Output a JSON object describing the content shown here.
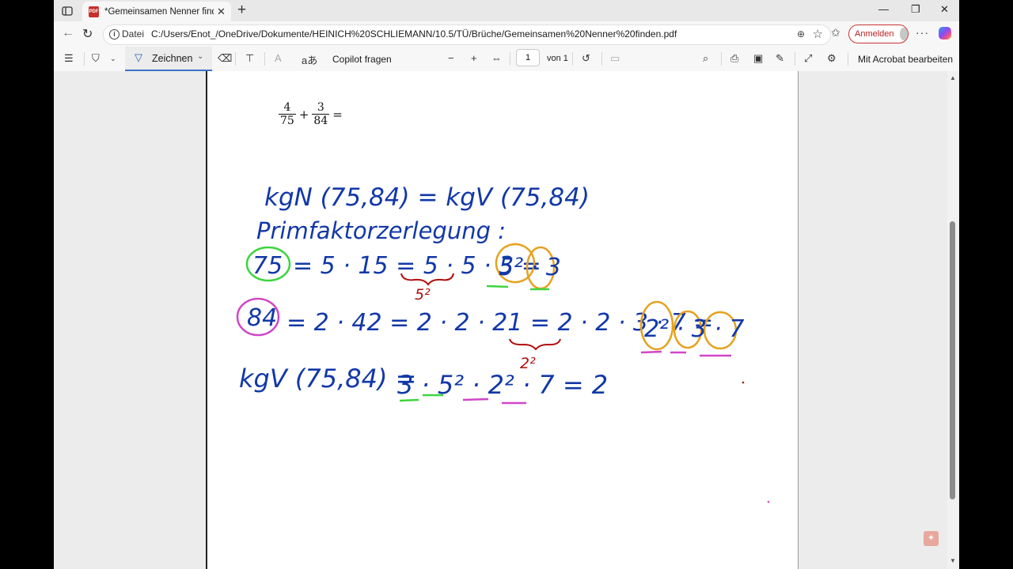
{
  "browser": {
    "tab_title": "*Gemeinsamen Nenner finden.pdf",
    "tab_close": "✕",
    "new_tab": "+",
    "controls": {
      "minimize": "—",
      "restore": "❐",
      "close": "✕"
    },
    "address": {
      "scheme_label": "Datei",
      "url": "C:/Users/Enot_/OneDrive/Dokumente/HEINICH%20SCHLIEMANN/10.5/TÜ/Brüche/Gemeinsamen%20Nenner%20finden.pdf"
    },
    "sign_in_label": "Anmelden",
    "more_label": "···"
  },
  "pdf_toolbar": {
    "draw_label": "Zeichnen",
    "copilot_label": "Copilot fragen",
    "page_current": "1",
    "page_of": "von 1",
    "acrobat_label": "Mit Acrobat bearbeiten",
    "read_aloud_glyph": "aあ",
    "text_glyph": "A"
  },
  "document": {
    "fraction1": {
      "num": "4",
      "den": "75"
    },
    "fraction2": {
      "num": "3",
      "den": "84"
    },
    "plus": "+",
    "equals": "=",
    "handwriting": {
      "line1": "kgN (75,84) = kgV (75,84)",
      "line2": "Primfaktorzerlegung :",
      "line3_circled": "75",
      "line3_rest": "= 5 · 15 = 5 · 5 · 3 =",
      "line3_result": "5² · 3",
      "line3_brace_label": "5²",
      "line4_circled": "84",
      "line4_rest": "= 2 · 42 = 2 · 2 · 21 = 2 · 2 · 3 · 7 =",
      "line4_result": "2² · 3 · 7",
      "line4_brace_label": "2²",
      "line5_lhs": "kgV (75,84) =",
      "line5_rhs": "3 · 5² · 2² · 7 = 2"
    }
  },
  "colors": {
    "ink_blue": "#1238a8",
    "ink_red": "#b01010",
    "highlight_green": "#3fd43f",
    "highlight_orange": "#e6a21e",
    "highlight_pink": "#d046c8"
  }
}
